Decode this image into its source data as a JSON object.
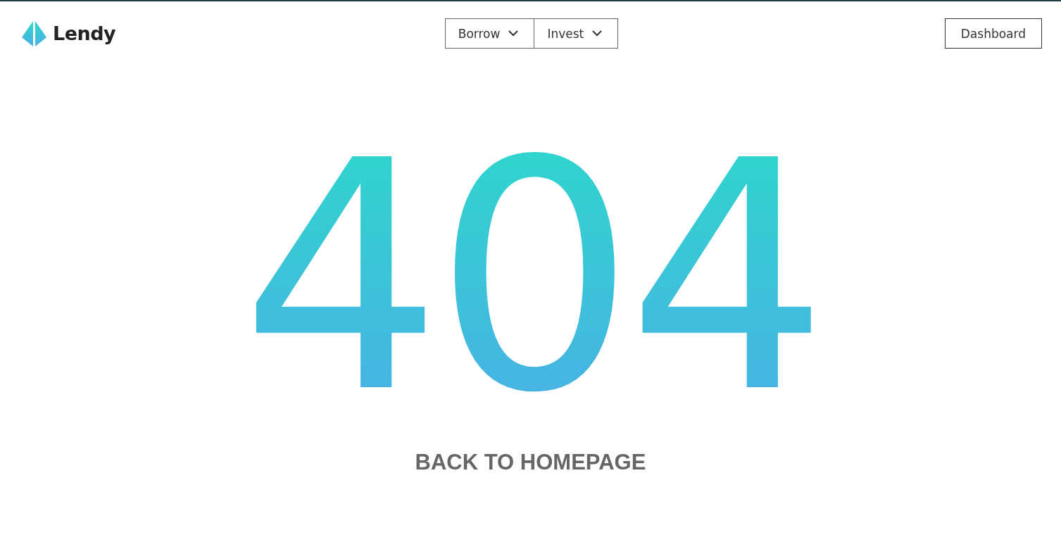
{
  "header": {
    "logo": "Lendy",
    "nav": [
      {
        "label": "Borrow"
      },
      {
        "label": "Invest"
      }
    ],
    "dashboard_button": "Dashboard"
  },
  "error_code": "404",
  "back_link": "BACK TO HOMEPAGE"
}
